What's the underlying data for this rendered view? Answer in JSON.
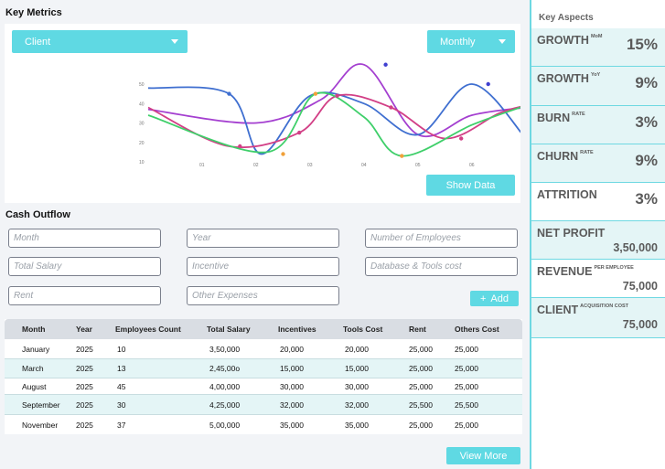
{
  "key_metrics": {
    "title": "Key Metrics",
    "client_dropdown": "Client",
    "period_dropdown": "Monthly",
    "show_data_label": "Show Data",
    "colors": {
      "accent": "#5fd9e3",
      "purple": "#a43fd0",
      "blue": "#3f6fd0",
      "pink": "#d23f86",
      "green": "#3fcf6a"
    }
  },
  "chart_data": {
    "type": "line",
    "categories": [
      "01",
      "02",
      "03",
      "04",
      "05",
      "06",
      "07"
    ],
    "y_ticks": [
      "10",
      "20",
      "30",
      "40",
      "50"
    ],
    "ylim": [
      10,
      50
    ],
    "grid": false,
    "legend": "none",
    "series": [
      {
        "color": "#a43fd0",
        "points": [
          [
            0,
            37
          ],
          [
            2,
            30
          ],
          [
            3.2,
            42
          ],
          [
            4,
            60
          ],
          [
            5,
            24
          ],
          [
            6,
            34
          ],
          [
            7,
            38
          ]
        ]
      },
      {
        "color": "#3f6fd0",
        "points": [
          [
            0,
            48
          ],
          [
            1.5,
            45
          ],
          [
            2.1,
            14
          ],
          [
            3,
            44
          ],
          [
            4,
            40
          ],
          [
            5,
            24
          ],
          [
            6,
            50
          ],
          [
            7,
            22
          ]
        ]
      },
      {
        "color": "#d23f86",
        "points": [
          [
            0,
            38
          ],
          [
            1.5,
            18
          ],
          [
            2.8,
            25
          ],
          [
            3.5,
            44
          ],
          [
            4.5,
            38
          ],
          [
            5.5,
            22
          ],
          [
            6.5,
            35
          ],
          [
            7,
            39
          ]
        ]
      },
      {
        "color": "#3fcf6a",
        "points": [
          [
            0,
            34
          ],
          [
            2.2,
            15
          ],
          [
            3.1,
            45
          ],
          [
            4,
            33
          ],
          [
            4.7,
            13
          ],
          [
            6,
            29
          ],
          [
            7,
            39
          ]
        ]
      }
    ],
    "markers": [
      {
        "x": 1.5,
        "y": 45,
        "color": "#3f6fd0"
      },
      {
        "x": 1.7,
        "y": 18,
        "color": "#d23f86"
      },
      {
        "x": 2.5,
        "y": 14,
        "color": "#f0a13a"
      },
      {
        "x": 3.1,
        "y": 45,
        "color": "#f0a13a"
      },
      {
        "x": 3.5,
        "y": 44,
        "color": "#d23f86"
      },
      {
        "x": 2.8,
        "y": 25,
        "color": "#d23f86"
      },
      {
        "x": 4.4,
        "y": 60,
        "color": "#3f3fd0"
      },
      {
        "x": 4.5,
        "y": 38,
        "color": "#d23f86"
      },
      {
        "x": 4.7,
        "y": 13,
        "color": "#f0a13a"
      },
      {
        "x": 5.8,
        "y": 22,
        "color": "#d23f86"
      },
      {
        "x": 6.3,
        "y": 50,
        "color": "#3f3fd0"
      }
    ]
  },
  "cash_outflow": {
    "title": "Cash Outflow",
    "placeholders": {
      "month": "Month",
      "year": "Year",
      "employees": "Number of Employees",
      "salary": "Total Salary",
      "incentive": "Incentive",
      "tools": "Database & Tools cost",
      "rent": "Rent",
      "other": "Other Expenses"
    },
    "add_label": "Add",
    "add_icon": "plus-icon"
  },
  "table": {
    "headers": [
      "Month",
      "Year",
      "Employees Count",
      "Total Salary",
      "Incentives",
      "Tools Cost",
      "Rent",
      "Others Cost"
    ],
    "rows": [
      [
        "January",
        "2025",
        "10",
        "3,50,000",
        "20,000",
        "20,000",
        "25,000",
        "25,000"
      ],
      [
        "March",
        "2025",
        "13",
        "2,45,00o",
        "15,000",
        "15,000",
        "25,000",
        "25,000"
      ],
      [
        "August",
        "2025",
        "45",
        "4,00,000",
        "30,000",
        "30,000",
        "25,000",
        "25,000"
      ],
      [
        "September",
        "2025",
        "30",
        "4,25,000",
        "32,000",
        "32,000",
        "25,500",
        "25,500"
      ],
      [
        "November",
        "2025",
        "37",
        "5,00,000",
        "35,000",
        "35,000",
        "25,000",
        "25,000"
      ]
    ],
    "view_more_label": "View More"
  },
  "key_aspects": {
    "title": "Key Aspects",
    "metrics": [
      {
        "name": "GROWTH",
        "sup": "MoM",
        "value": "15%"
      },
      {
        "name": "GROWTH",
        "sup": "YoY",
        "value": "9%"
      },
      {
        "name": "BURN",
        "sup": "RATE",
        "value": "3%"
      },
      {
        "name": "CHURN",
        "sup": "RATE",
        "value": "9%"
      },
      {
        "name": "ATTRITION",
        "sup": "",
        "value": "3%"
      },
      {
        "name": "NET PROFIT",
        "sup": "",
        "value": "3,50,000"
      },
      {
        "name": "REVENUE",
        "sup": "PER EMPLOYEE",
        "value": "75,000"
      },
      {
        "name": "CLIENT",
        "sup": "ACQUISITION COST",
        "value": "75,000"
      }
    ]
  }
}
